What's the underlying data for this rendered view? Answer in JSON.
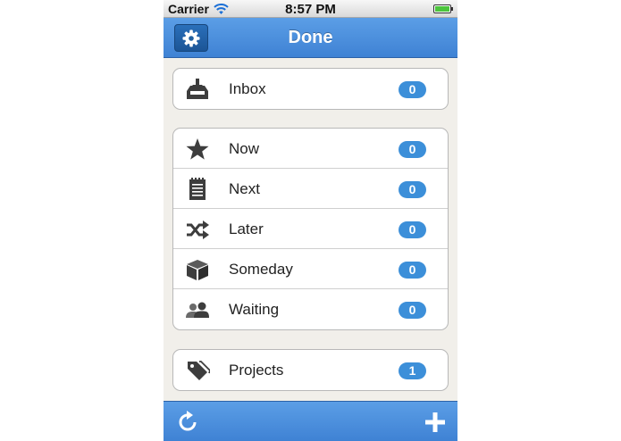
{
  "status_bar": {
    "carrier": "Carrier",
    "time": "8:57 PM",
    "wifi_icon": "wifi-icon",
    "battery_icon": "battery-icon"
  },
  "nav": {
    "title": "Done",
    "settings_icon": "gear-icon"
  },
  "inbox_group": [
    {
      "label": "Inbox",
      "count": "0",
      "icon": "inbox-icon"
    }
  ],
  "context_group": [
    {
      "label": "Now",
      "count": "0",
      "icon": "star-icon"
    },
    {
      "label": "Next",
      "count": "0",
      "icon": "notepad-icon"
    },
    {
      "label": "Later",
      "count": "0",
      "icon": "shuffle-icon"
    },
    {
      "label": "Someday",
      "count": "0",
      "icon": "box-icon"
    },
    {
      "label": "Waiting",
      "count": "0",
      "icon": "people-icon"
    }
  ],
  "projects_group": [
    {
      "label": "Projects",
      "count": "1",
      "icon": "tag-icon"
    }
  ],
  "toolbar": {
    "refresh_icon": "refresh-icon",
    "add_icon": "plus-icon"
  },
  "colors": {
    "bar_blue": "#4a8fdf",
    "badge_blue": "#3c8fd9",
    "background": "#f1efea"
  }
}
